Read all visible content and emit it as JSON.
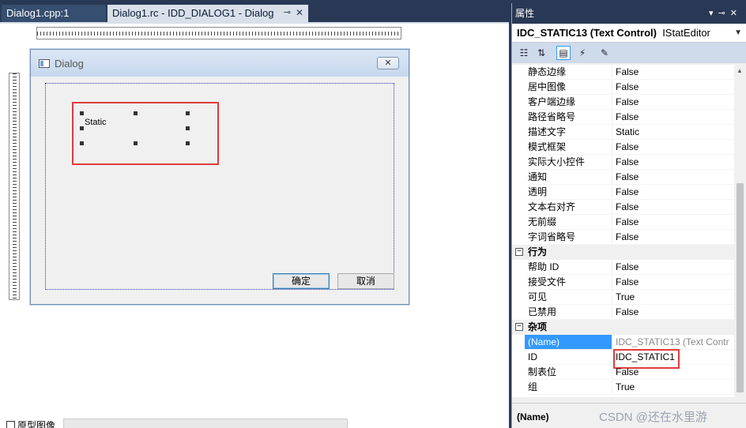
{
  "tabs": [
    {
      "label": "Dialog1.cpp:1",
      "active": false
    },
    {
      "label": "Dialog1.rc - IDD_DIALOG1 - Dialog",
      "active": true
    }
  ],
  "dialog": {
    "title": "Dialog",
    "close_glyph": "✕",
    "static_text": "Static",
    "ok_label": "确定",
    "cancel_label": "取消"
  },
  "editor": {
    "checkbox_label": "原型图像"
  },
  "props": {
    "header_title": "属性",
    "object_name": "IDC_STATIC13 (Text Control)",
    "object_editor": "IStatEditor",
    "rows": [
      {
        "name": "静态边缘",
        "value": "False"
      },
      {
        "name": "居中图像",
        "value": "False"
      },
      {
        "name": "客户端边缘",
        "value": "False"
      },
      {
        "name": "路径省略号",
        "value": "False"
      },
      {
        "name": "描述文字",
        "value": "Static"
      },
      {
        "name": "模式框架",
        "value": "False"
      },
      {
        "name": "实际大小控件",
        "value": "False"
      },
      {
        "name": "通知",
        "value": "False"
      },
      {
        "name": "透明",
        "value": "False"
      },
      {
        "name": "文本右对齐",
        "value": "False"
      },
      {
        "name": "无前缀",
        "value": "False"
      },
      {
        "name": "字词省略号",
        "value": "False"
      }
    ],
    "cat_behavior": "行为",
    "behavior_rows": [
      {
        "name": "帮助 ID",
        "value": "False"
      },
      {
        "name": "接受文件",
        "value": "False"
      },
      {
        "name": "可见",
        "value": "True"
      },
      {
        "name": "已禁用",
        "value": "False"
      }
    ],
    "cat_misc": "杂项",
    "misc_rows": [
      {
        "name": "(Name)",
        "value": "IDC_STATIC13 (Text Contr"
      },
      {
        "name": "ID",
        "value": "IDC_STATIC1"
      },
      {
        "name": "制表位",
        "value": "False"
      },
      {
        "name": "组",
        "value": "True"
      }
    ],
    "desc_name": "(Name)",
    "watermark": "CSDN @还在水里游"
  }
}
